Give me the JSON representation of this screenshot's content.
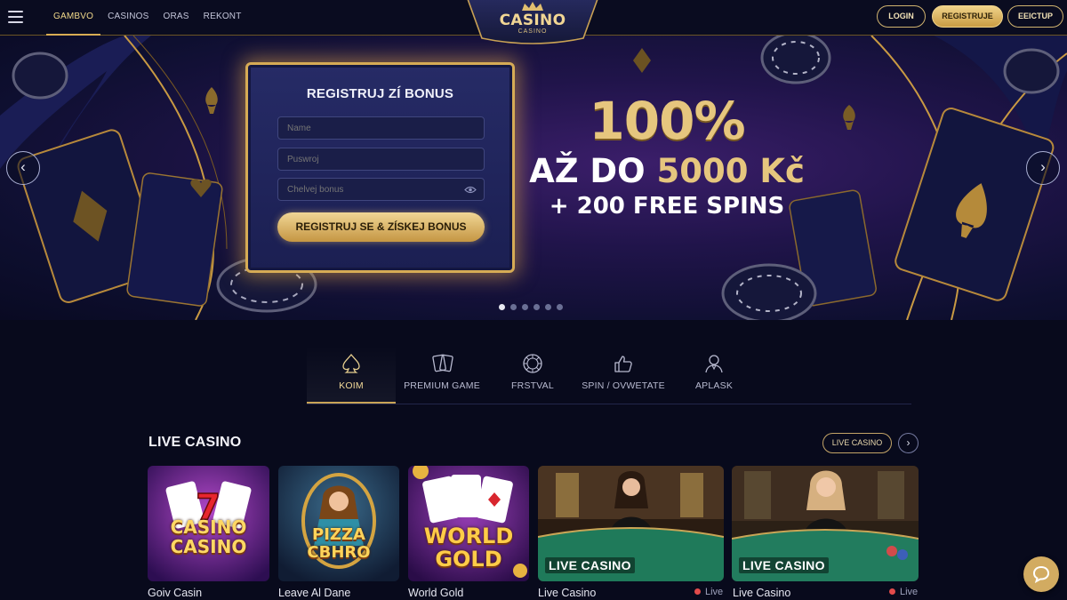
{
  "header": {
    "nav": [
      "GAMBVO",
      "CASINOS",
      "ORAS",
      "REKONT"
    ],
    "logo": {
      "title": "CASINO",
      "subtitle": "CASINO"
    },
    "login_label": "LOGIN",
    "register_label": "REGISTRUJE",
    "exit_label": "EEICTUP"
  },
  "hero": {
    "form": {
      "title": "REGISTRUJ ZÍ BONUS",
      "name_placeholder": "Name",
      "password_placeholder": "Puswroj",
      "bonus_placeholder": "Chelvej bonus",
      "submit_label": "REGISTRUJ SE & ZÍSKEJ BONUS"
    },
    "promo": {
      "percent": "100%",
      "line2_prefix": "AŽ DO ",
      "line2_amount": "5000 Kč",
      "line3": "+ 200 FREE SPINS"
    },
    "slides_total": 6,
    "active_slide": 1
  },
  "categories": [
    {
      "label": "KOIM",
      "icon": "spade-icon",
      "active": true
    },
    {
      "label": "PREMIUM GAME",
      "icon": "cards-icon",
      "active": false
    },
    {
      "label": "FRSTVAL",
      "icon": "roulette-icon",
      "active": false
    },
    {
      "label": "SPIN / OVWETATE",
      "icon": "thumbs-up-icon",
      "active": false
    },
    {
      "label": "APLASK",
      "icon": "dealer-icon",
      "active": false
    }
  ],
  "live_section": {
    "title": "LIVE CASINO",
    "button_label": "LIVE CASINO",
    "games": [
      {
        "name": "Goiv Casin",
        "thumb_text": "CASINO\nCASINO",
        "live": false
      },
      {
        "name": "Leave Al Dane",
        "thumb_text": "PIZZA\nCBHRO",
        "live": false
      },
      {
        "name": "World Gold",
        "thumb_text": "WORLD\nGOLD",
        "live": false
      },
      {
        "name": "Live Casino",
        "thumb_text": "LIVE CASINO",
        "live": true,
        "live_label": "Live"
      },
      {
        "name": "Live Casino",
        "thumb_text": "LIVE CASINO",
        "live": true,
        "live_label": "Live"
      }
    ]
  },
  "colors": {
    "gold": "#d6ab55",
    "background": "#080a1c",
    "hero_purple": "#3b1e6a",
    "live_dot": "#e24b4b"
  }
}
